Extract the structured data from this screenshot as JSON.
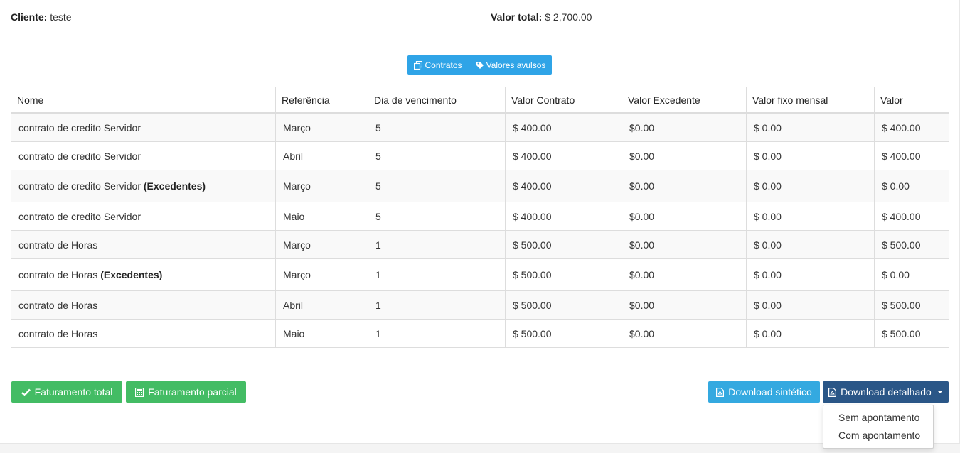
{
  "summary": {
    "client_label": "Cliente:",
    "client_value": "teste",
    "total_label": "Valor total:",
    "total_value": "$ 2,700.00"
  },
  "toggle": {
    "contratos_label": "Contratos",
    "avulsos_label": "Valores avulsos"
  },
  "table": {
    "headers": [
      "Nome",
      "Referência",
      "Dia de vencimento",
      "Valor Contrato",
      "Valor Excedente",
      "Valor fixo mensal",
      "Valor"
    ],
    "rows": [
      {
        "name": "contrato de credito Servidor",
        "badge": "",
        "ref": "Março",
        "dia": "5",
        "contrato": "$ 400.00",
        "excedente": "$0.00",
        "fixo": "$ 0.00",
        "valor": "$ 400.00"
      },
      {
        "name": "contrato de credito Servidor",
        "badge": "",
        "ref": "Abril",
        "dia": "5",
        "contrato": "$ 400.00",
        "excedente": "$0.00",
        "fixo": "$ 0.00",
        "valor": "$ 400.00"
      },
      {
        "name": "contrato de credito Servidor",
        "badge": "(Excedentes)",
        "ref": "Março",
        "dia": "5",
        "contrato": "$ 400.00",
        "excedente": "$0.00",
        "fixo": "$ 0.00",
        "valor": "$ 0.00"
      },
      {
        "name": "contrato de credito Servidor",
        "badge": "",
        "ref": "Maio",
        "dia": "5",
        "contrato": "$ 400.00",
        "excedente": "$0.00",
        "fixo": "$ 0.00",
        "valor": "$ 400.00"
      },
      {
        "name": "contrato de Horas",
        "badge": "",
        "ref": "Março",
        "dia": "1",
        "contrato": "$ 500.00",
        "excedente": "$0.00",
        "fixo": "$ 0.00",
        "valor": "$ 500.00"
      },
      {
        "name": "contrato de Horas",
        "badge": "(Excedentes)",
        "ref": "Março",
        "dia": "1",
        "contrato": "$ 500.00",
        "excedente": "$0.00",
        "fixo": "$ 0.00",
        "valor": "$ 0.00"
      },
      {
        "name": "contrato de Horas",
        "badge": "",
        "ref": "Abril",
        "dia": "1",
        "contrato": "$ 500.00",
        "excedente": "$0.00",
        "fixo": "$ 0.00",
        "valor": "$ 500.00"
      },
      {
        "name": "contrato de Horas",
        "badge": "",
        "ref": "Maio",
        "dia": "1",
        "contrato": "$ 500.00",
        "excedente": "$0.00",
        "fixo": "$ 0.00",
        "valor": "$ 500.00"
      }
    ]
  },
  "actions": {
    "faturamento_total": "Faturamento total",
    "faturamento_parcial": "Faturamento parcial",
    "download_sintetico": "Download sintético",
    "download_detalhado": "Download detalhado"
  },
  "dropdown": {
    "items": [
      "Sem apontamento",
      "Com apontamento"
    ]
  },
  "icons": {
    "contratos": "copy-icon",
    "avulsos": "tag-icon",
    "faturamento_total": "check-icon",
    "faturamento_parcial": "calculator-icon",
    "download": "file-pdf-icon",
    "dropdown": "caret-down-icon"
  },
  "colors": {
    "primary": "#2fa4e7",
    "success": "#43bc64",
    "dark": "#2a5687"
  }
}
